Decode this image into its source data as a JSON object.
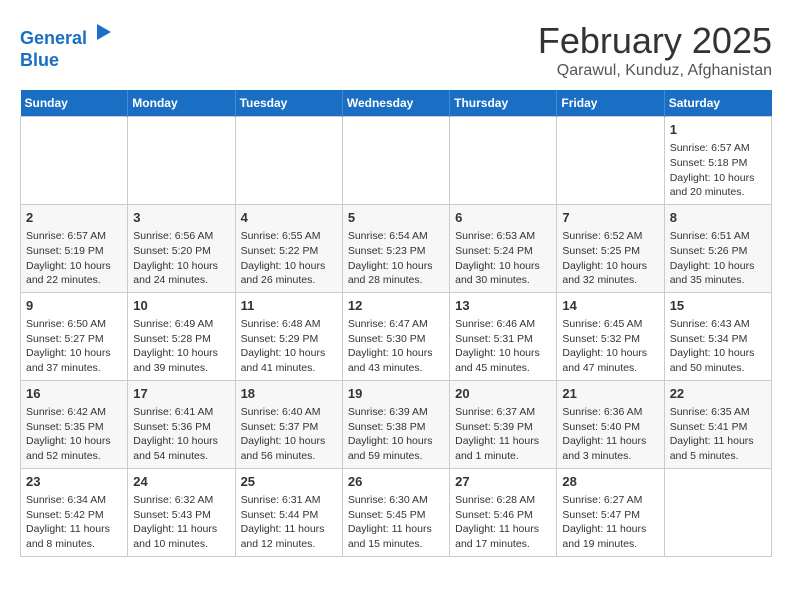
{
  "header": {
    "logo_line1": "General",
    "logo_line2": "Blue",
    "month": "February 2025",
    "location": "Qarawul, Kunduz, Afghanistan"
  },
  "weekdays": [
    "Sunday",
    "Monday",
    "Tuesday",
    "Wednesday",
    "Thursday",
    "Friday",
    "Saturday"
  ],
  "weeks": [
    [
      {
        "day": "",
        "text": ""
      },
      {
        "day": "",
        "text": ""
      },
      {
        "day": "",
        "text": ""
      },
      {
        "day": "",
        "text": ""
      },
      {
        "day": "",
        "text": ""
      },
      {
        "day": "",
        "text": ""
      },
      {
        "day": "1",
        "text": "Sunrise: 6:57 AM\nSunset: 5:18 PM\nDaylight: 10 hours and 20 minutes."
      }
    ],
    [
      {
        "day": "2",
        "text": "Sunrise: 6:57 AM\nSunset: 5:19 PM\nDaylight: 10 hours and 22 minutes."
      },
      {
        "day": "3",
        "text": "Sunrise: 6:56 AM\nSunset: 5:20 PM\nDaylight: 10 hours and 24 minutes."
      },
      {
        "day": "4",
        "text": "Sunrise: 6:55 AM\nSunset: 5:22 PM\nDaylight: 10 hours and 26 minutes."
      },
      {
        "day": "5",
        "text": "Sunrise: 6:54 AM\nSunset: 5:23 PM\nDaylight: 10 hours and 28 minutes."
      },
      {
        "day": "6",
        "text": "Sunrise: 6:53 AM\nSunset: 5:24 PM\nDaylight: 10 hours and 30 minutes."
      },
      {
        "day": "7",
        "text": "Sunrise: 6:52 AM\nSunset: 5:25 PM\nDaylight: 10 hours and 32 minutes."
      },
      {
        "day": "8",
        "text": "Sunrise: 6:51 AM\nSunset: 5:26 PM\nDaylight: 10 hours and 35 minutes."
      }
    ],
    [
      {
        "day": "9",
        "text": "Sunrise: 6:50 AM\nSunset: 5:27 PM\nDaylight: 10 hours and 37 minutes."
      },
      {
        "day": "10",
        "text": "Sunrise: 6:49 AM\nSunset: 5:28 PM\nDaylight: 10 hours and 39 minutes."
      },
      {
        "day": "11",
        "text": "Sunrise: 6:48 AM\nSunset: 5:29 PM\nDaylight: 10 hours and 41 minutes."
      },
      {
        "day": "12",
        "text": "Sunrise: 6:47 AM\nSunset: 5:30 PM\nDaylight: 10 hours and 43 minutes."
      },
      {
        "day": "13",
        "text": "Sunrise: 6:46 AM\nSunset: 5:31 PM\nDaylight: 10 hours and 45 minutes."
      },
      {
        "day": "14",
        "text": "Sunrise: 6:45 AM\nSunset: 5:32 PM\nDaylight: 10 hours and 47 minutes."
      },
      {
        "day": "15",
        "text": "Sunrise: 6:43 AM\nSunset: 5:34 PM\nDaylight: 10 hours and 50 minutes."
      }
    ],
    [
      {
        "day": "16",
        "text": "Sunrise: 6:42 AM\nSunset: 5:35 PM\nDaylight: 10 hours and 52 minutes."
      },
      {
        "day": "17",
        "text": "Sunrise: 6:41 AM\nSunset: 5:36 PM\nDaylight: 10 hours and 54 minutes."
      },
      {
        "day": "18",
        "text": "Sunrise: 6:40 AM\nSunset: 5:37 PM\nDaylight: 10 hours and 56 minutes."
      },
      {
        "day": "19",
        "text": "Sunrise: 6:39 AM\nSunset: 5:38 PM\nDaylight: 10 hours and 59 minutes."
      },
      {
        "day": "20",
        "text": "Sunrise: 6:37 AM\nSunset: 5:39 PM\nDaylight: 11 hours and 1 minute."
      },
      {
        "day": "21",
        "text": "Sunrise: 6:36 AM\nSunset: 5:40 PM\nDaylight: 11 hours and 3 minutes."
      },
      {
        "day": "22",
        "text": "Sunrise: 6:35 AM\nSunset: 5:41 PM\nDaylight: 11 hours and 5 minutes."
      }
    ],
    [
      {
        "day": "23",
        "text": "Sunrise: 6:34 AM\nSunset: 5:42 PM\nDaylight: 11 hours and 8 minutes."
      },
      {
        "day": "24",
        "text": "Sunrise: 6:32 AM\nSunset: 5:43 PM\nDaylight: 11 hours and 10 minutes."
      },
      {
        "day": "25",
        "text": "Sunrise: 6:31 AM\nSunset: 5:44 PM\nDaylight: 11 hours and 12 minutes."
      },
      {
        "day": "26",
        "text": "Sunrise: 6:30 AM\nSunset: 5:45 PM\nDaylight: 11 hours and 15 minutes."
      },
      {
        "day": "27",
        "text": "Sunrise: 6:28 AM\nSunset: 5:46 PM\nDaylight: 11 hours and 17 minutes."
      },
      {
        "day": "28",
        "text": "Sunrise: 6:27 AM\nSunset: 5:47 PM\nDaylight: 11 hours and 19 minutes."
      },
      {
        "day": "",
        "text": ""
      }
    ]
  ]
}
